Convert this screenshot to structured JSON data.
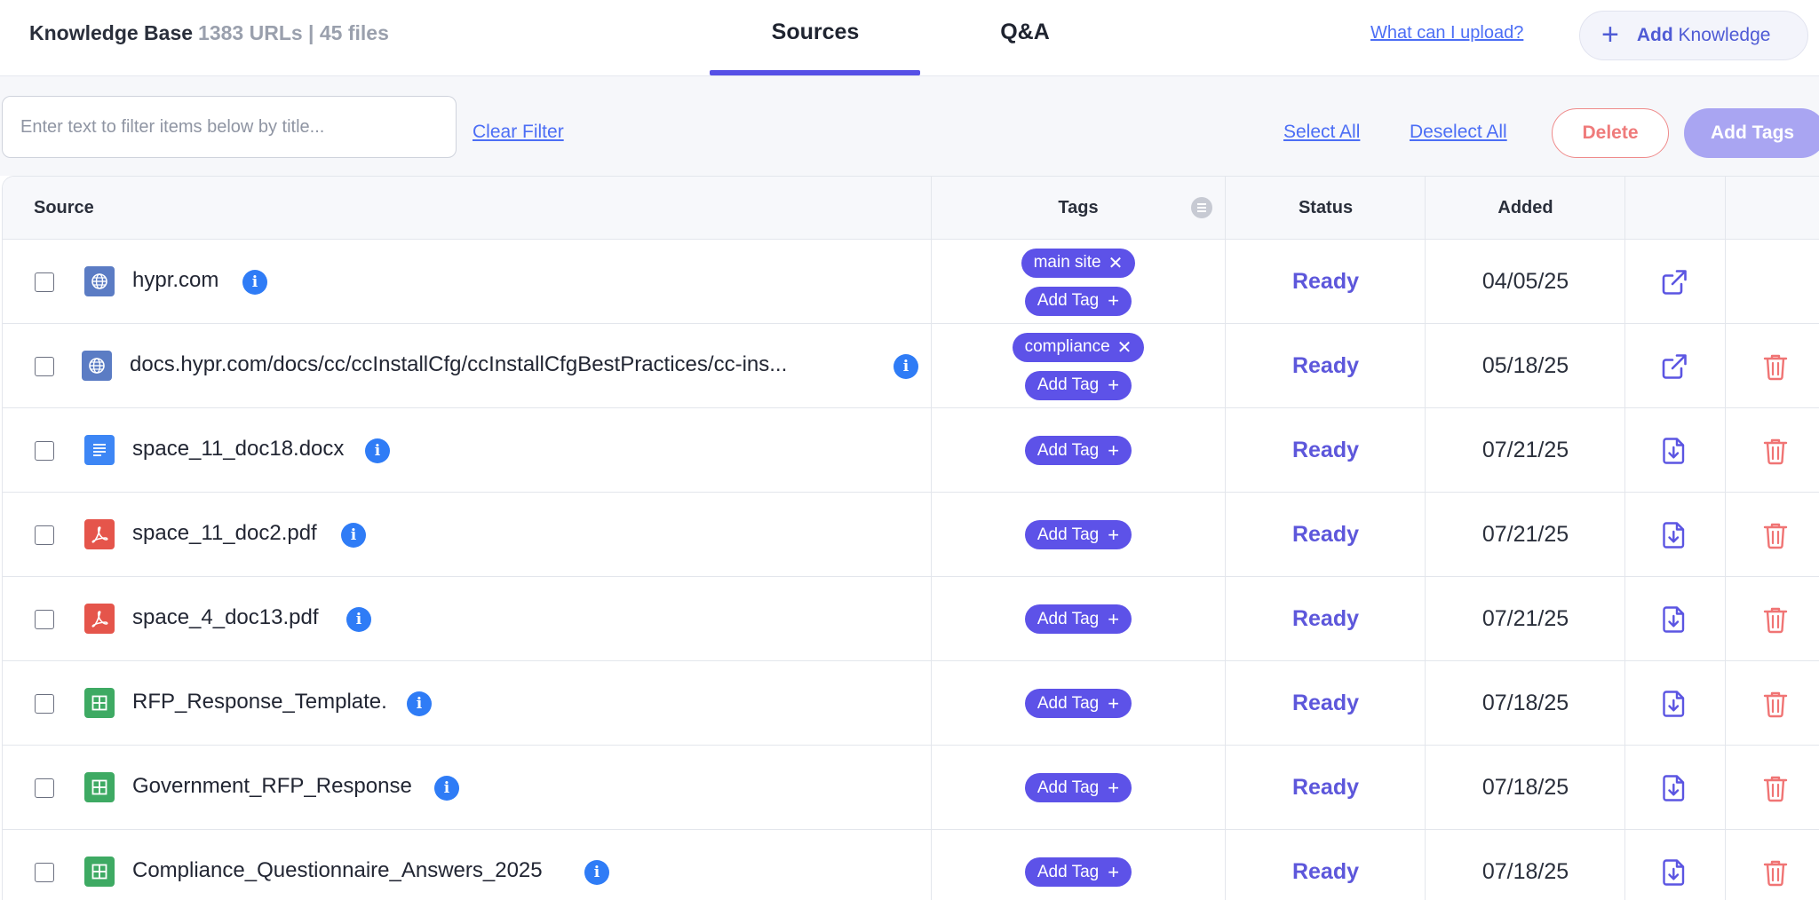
{
  "header": {
    "title": "Knowledge Base",
    "count": "1383 URLs | 45 files",
    "tabs": [
      {
        "label": "Sources",
        "active": true
      },
      {
        "label": "Q&A",
        "active": false
      }
    ],
    "upload_link": "What can I upload?",
    "add_button": {
      "bold": "Add",
      "rest": "Knowledge"
    }
  },
  "filter": {
    "placeholder": "Enter text to filter items below by title...",
    "clear": "Clear Filter",
    "select_all": "Select All",
    "deselect_all": "Deselect All",
    "delete": "Delete",
    "add_tags": "Add Tags"
  },
  "table": {
    "columns": {
      "source": "Source",
      "tags": "Tags",
      "status": "Status",
      "added": "Added"
    },
    "add_tag_label": "Add Tag",
    "rows": [
      {
        "type": "web",
        "name": "hypr.com",
        "tag": "main site",
        "status": "Ready",
        "added": "04/05/25",
        "action": "open-external",
        "deletable": false
      },
      {
        "type": "web",
        "name": "docs.hypr.com/docs/cc/ccInstallCfg/ccInstallCfgBestPractices/cc-ins...",
        "tag": "compliance",
        "status": "Ready",
        "added": "05/18/25",
        "action": "open-external",
        "deletable": true
      },
      {
        "type": "doc",
        "name": "space_11_doc18.docx",
        "tag": "",
        "status": "Ready",
        "added": "07/21/25",
        "action": "download",
        "deletable": true
      },
      {
        "type": "pdf",
        "name": "space_11_doc2.pdf",
        "tag": "",
        "status": "Ready",
        "added": "07/21/25",
        "action": "download",
        "deletable": true
      },
      {
        "type": "pdf",
        "name": "space_4_doc13.pdf",
        "tag": "",
        "status": "Ready",
        "added": "07/21/25",
        "action": "download",
        "deletable": true
      },
      {
        "type": "xls",
        "name": "RFP_Response_Template.",
        "tag": "",
        "status": "Ready",
        "added": "07/18/25",
        "action": "download",
        "deletable": true
      },
      {
        "type": "xls",
        "name": "Government_RFP_Response",
        "tag": "",
        "status": "Ready",
        "added": "07/18/25",
        "action": "download",
        "deletable": true
      },
      {
        "type": "xls",
        "name": "Compliance_Questionnaire_Answers_2025",
        "tag": "",
        "status": "Ready",
        "added": "07/18/25",
        "action": "download",
        "deletable": true
      }
    ]
  },
  "colors": {
    "accent": "#5650e6",
    "link": "#4c6ef5",
    "status": "#5d57db",
    "danger": "#ef7b7b",
    "info": "#2f7cf6"
  }
}
